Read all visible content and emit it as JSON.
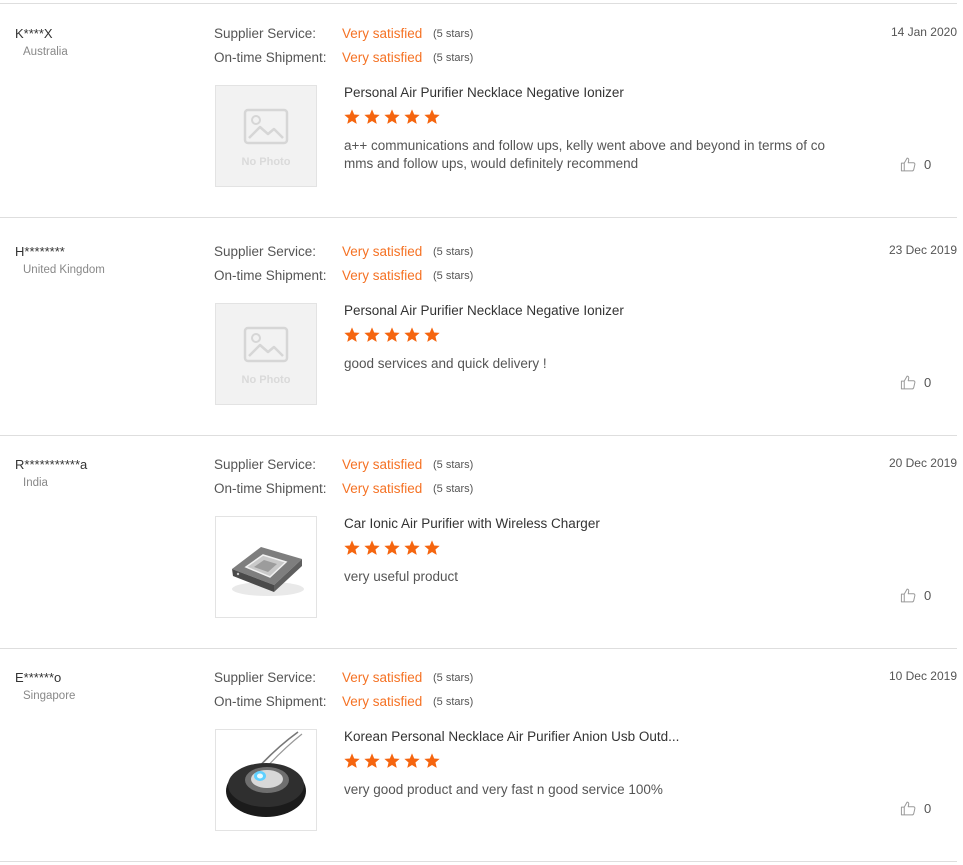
{
  "reviews": [
    {
      "buyer": "K****X",
      "country": "Australia",
      "supplier_label": "Supplier Service:",
      "supplier_value": "Very satisfied",
      "supplier_stars": "(5 stars)",
      "shipment_label": "On-time Shipment:",
      "shipment_value": "Very satisfied",
      "shipment_stars": "(5 stars)",
      "date": "14 Jan 2020",
      "photo_text": "No Photo",
      "product": "Personal Air Purifier Necklace Negative Ionizer",
      "rating": 5,
      "comment": "a++ communications and follow ups, kelly went above and beyond in terms of co mms and follow ups, would definitely recommend",
      "likes": "0",
      "image": "no-photo"
    },
    {
      "buyer": "H********",
      "country": "United Kingdom",
      "supplier_label": "Supplier Service:",
      "supplier_value": "Very satisfied",
      "supplier_stars": "(5 stars)",
      "shipment_label": "On-time Shipment:",
      "shipment_value": "Very satisfied",
      "shipment_stars": "(5 stars)",
      "date": "23 Dec 2019",
      "photo_text": "No Photo",
      "product": "Personal Air Purifier Necklace Negative Ionizer",
      "rating": 5,
      "comment": "good services and quick delivery !",
      "likes": "0",
      "image": "no-photo"
    },
    {
      "buyer": "R***********a",
      "country": "India",
      "supplier_label": "Supplier Service:",
      "supplier_value": "Very satisfied",
      "supplier_stars": "(5 stars)",
      "shipment_label": "On-time Shipment:",
      "shipment_value": "Very satisfied",
      "shipment_stars": "(5 stars)",
      "date": "20 Dec 2019",
      "product": "Car Ionic Air Purifier with Wireless Charger",
      "rating": 5,
      "comment": "very useful product",
      "likes": "0",
      "image": "car-purifier"
    },
    {
      "buyer": "E******o",
      "country": "Singapore",
      "supplier_label": "Supplier Service:",
      "supplier_value": "Very satisfied",
      "supplier_stars": "(5 stars)",
      "shipment_label": "On-time Shipment:",
      "shipment_value": "Very satisfied",
      "shipment_stars": "(5 stars)",
      "date": "10 Dec 2019",
      "product": "Korean Personal Necklace Air Purifier Anion Usb Outd...",
      "rating": 5,
      "comment": "very good product and very fast n good service 100%",
      "likes": "0",
      "image": "necklace-purifier"
    }
  ],
  "colors": {
    "accent": "#f57224",
    "star": "#f5650f",
    "divider": "#dedede"
  },
  "icons": {
    "placeholder": "image-placeholder-icon",
    "star": "star-icon",
    "like": "thumbs-up-icon"
  }
}
